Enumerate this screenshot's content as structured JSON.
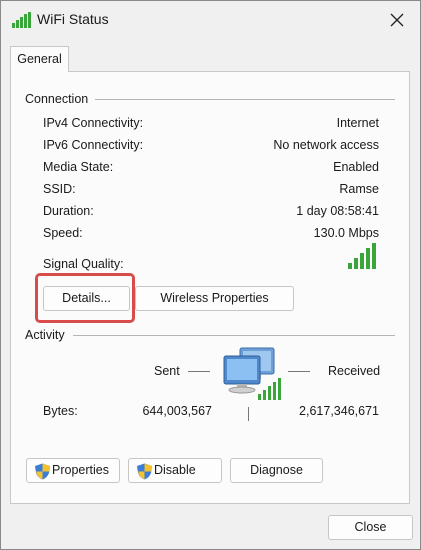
{
  "window": {
    "title": "WiFi Status",
    "close_icon": "close-icon",
    "app_icon": "wifi-signal-icon"
  },
  "tab": {
    "label": "General"
  },
  "connection": {
    "heading": "Connection",
    "rows": [
      {
        "label": "IPv4 Connectivity:",
        "value": "Internet"
      },
      {
        "label": "IPv6 Connectivity:",
        "value": "No network access"
      },
      {
        "label": "Media State:",
        "value": "Enabled"
      },
      {
        "label": "SSID:",
        "value": "Ramse"
      },
      {
        "label": "Duration:",
        "value": "1 day 08:58:41"
      },
      {
        "label": "Speed:",
        "value": "130.0 Mbps"
      }
    ],
    "signal_label": "Signal Quality:",
    "signal_bars": 5,
    "signal_bars_filled": 5,
    "details_button": "Details...",
    "wireless_button": "Wireless Properties"
  },
  "activity": {
    "heading": "Activity",
    "sent_label": "Sent",
    "received_label": "Received",
    "bytes_label": "Bytes:",
    "bytes_sent": "644,003,567",
    "bytes_received": "2,617,346,671",
    "properties_button": "Properties",
    "disable_button": "Disable",
    "diagnose_button": "Diagnose"
  },
  "footer": {
    "close_button": "Close"
  },
  "colors": {
    "highlight": "#d94c4c",
    "signal": "#3aa53a"
  }
}
